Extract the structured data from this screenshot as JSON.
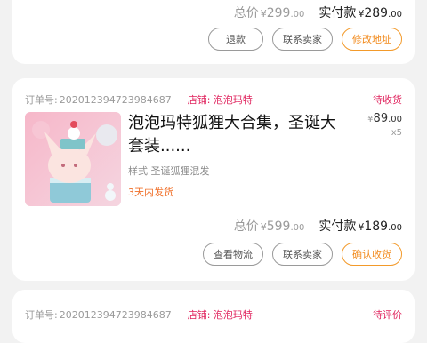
{
  "order_top": {
    "total_label": "总价",
    "total_currency": "¥",
    "total_int": "299",
    "total_dec": ".00",
    "paid_label": "实付款",
    "paid_currency": "¥",
    "paid_int": "289",
    "paid_dec": ".00",
    "buttons": [
      "退款",
      "联系卖家",
      "修改地址"
    ]
  },
  "order_mid": {
    "order_no_label": "订单号:",
    "order_no": "20201239472398468​7",
    "shop_label": "店铺: 泡泡玛特",
    "status": "待收货",
    "product_title": "泡泡玛特狐狸大合集，圣诞大套装......",
    "price_currency": "¥",
    "price_int": "89",
    "price_dec": ".00",
    "qty": "x5",
    "spec": "样式 圣诞狐狸混发",
    "shipping": "3天内发货",
    "total_label": "总价",
    "total_currency": "¥",
    "total_int": "599",
    "total_dec": ".00",
    "paid_label": "实付款",
    "paid_currency": "¥",
    "paid_int": "189",
    "paid_dec": ".00",
    "buttons": [
      "查看物流",
      "联系卖家",
      "确认收货"
    ]
  },
  "order_bottom": {
    "order_no_label": "订单号:",
    "order_no": "202012394723984687",
    "shop_label": "店铺: 泡泡玛特",
    "status": "待评价"
  }
}
